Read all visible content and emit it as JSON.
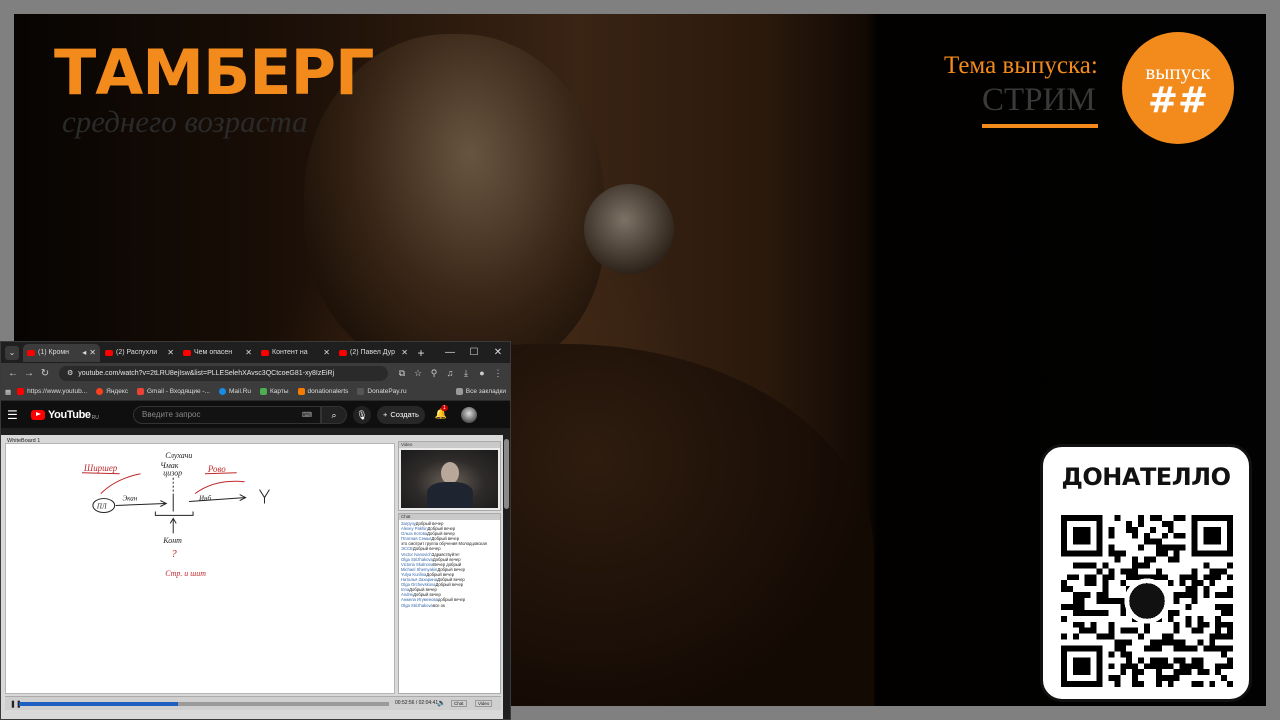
{
  "stream": {
    "logo_title": "ТАМБЕРГ",
    "logo_subtitle": "среднего возраста",
    "topic_label": "Тема выпуска:",
    "topic_value": "СТРИМ",
    "episode_label": "выпуск",
    "episode_number": "##",
    "donate_title": "ДОНАТЕЛЛО",
    "accent_color": "#f28a1c"
  },
  "browser": {
    "tabs": [
      {
        "label": "(1) Кромн",
        "active": true,
        "icon": "youtube-icon"
      },
      {
        "label": "(2) Распухли",
        "active": false,
        "icon": "youtube-icon"
      },
      {
        "label": "Чем опасен",
        "active": false,
        "icon": "youtube-icon"
      },
      {
        "label": "Контент на",
        "active": false,
        "icon": "youtube-icon"
      },
      {
        "label": "(2) Павел Дур",
        "active": false,
        "icon": "youtube-icon"
      }
    ],
    "url": "youtube.com/watch?v=2tLRU8ejIsw&list=PLLESelehXAvsc3QCtcoeG81-xy8IzEiRj",
    "bookmarks": [
      {
        "label": "https://www.youtub...",
        "color": "#ff0000"
      },
      {
        "label": "Яндекс",
        "color": "#fc3f1d"
      },
      {
        "label": "Gmail - Входящие -...",
        "color": "#ea4335"
      },
      {
        "label": "Mail.Ru",
        "color": "#168de2"
      },
      {
        "label": "Карты",
        "color": "#4caf50"
      },
      {
        "label": "donationalerts",
        "color": "#f57c00"
      },
      {
        "label": "DonatePay.ru",
        "color": "#555555"
      }
    ],
    "all_bookmarks": "Все закладки"
  },
  "youtube": {
    "brand": "YouTube",
    "region": "RU",
    "search_placeholder": "Введите запрос",
    "create_label": "Создать",
    "notification_count": "1"
  },
  "player": {
    "whiteboard_title": "WhiteBoard 1",
    "video_panel_title": "Video",
    "chat_panel_title": "Chat",
    "timecode": "00:52:56 / 02:04:41",
    "chat_button": "Chat",
    "video_button": "Video",
    "progress": 0.43,
    "chat": [
      {
        "name": "Загрузу",
        "text": "Добрый вечер"
      },
      {
        "name": "Alexey Pakhin",
        "text": "Добрый вечер"
      },
      {
        "name": "Ольга Котова",
        "text": "Добрый вечер"
      },
      {
        "name": "Платная Семья",
        "text": "Добрый вечер"
      },
      {
        "name": "",
        "text": "это смотрит группа обучения Молодцовская"
      },
      {
        "name": "ЭССЕ",
        "text": "Добрый вечер"
      },
      {
        "name": "Vector Ivanovich",
        "text": "Здравствуйте!"
      },
      {
        "name": "Olga Strizhakova",
        "text": "Добрый вечер"
      },
      {
        "name": "Victoria Skalnova",
        "text": "Вечер добрый"
      },
      {
        "name": "Michael Shemyakin",
        "text": "Добрый вечер"
      },
      {
        "name": "Yulya Kurilina",
        "text": "Добрый вечер"
      },
      {
        "name": "Наталья Захарина",
        "text": "Добрый вечер"
      },
      {
        "name": "Olga Orchevskova",
        "text": "Добрый вечер"
      },
      {
        "name": "Inna",
        "text": "Добрый вечер"
      },
      {
        "name": "Andrei",
        "text": "Добрый вечер"
      },
      {
        "name": "Анжела Игуменова",
        "text": "добрый вечер"
      },
      {
        "name": "Olga Strizhakova",
        "text": "все ок"
      }
    ],
    "whiteboard_labels": {
      "left_top": "Ширшер",
      "top_center_1": "Слухачи",
      "top_center_2": "Чмак",
      "top_center_3": "цизор",
      "top_right": "Рово",
      "node_left": "ПЛ",
      "arrow_left": "Экан",
      "arrow_right": "Инб",
      "bottom_1": "Конт",
      "bottom_2": "?",
      "bottom_3": "Стр. и шит"
    }
  }
}
